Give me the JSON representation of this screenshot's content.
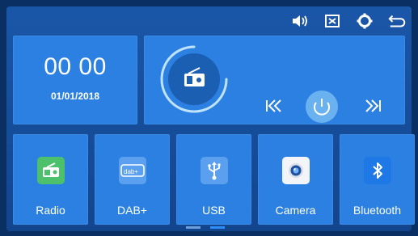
{
  "topbar": {
    "icons": [
      "volume-icon",
      "mute-icon",
      "settings-gear-icon",
      "back-icon"
    ]
  },
  "clock": {
    "time": "00 00",
    "date": "01/01/2018"
  },
  "player": {
    "source_icon": "radio-icon",
    "controls": [
      "previous-icon",
      "power-icon",
      "next-icon"
    ],
    "prev_glyph": "|<<",
    "next_glyph": ">>|"
  },
  "apps": [
    {
      "label": "Radio",
      "icon": "radio-icon",
      "color": "#4cc06a"
    },
    {
      "label": "DAB+",
      "icon": "dab-icon",
      "color": "#5aa0ee"
    },
    {
      "label": "USB",
      "icon": "usb-icon",
      "color": "#5aa0ee"
    },
    {
      "label": "Camera",
      "icon": "camera-icon",
      "color": "#f2f4f8"
    },
    {
      "label": "Bluetooth",
      "icon": "bluetooth-icon",
      "color": "#1e78e6"
    }
  ],
  "colors": {
    "accent": "#2b80e2",
    "background": "#0a2f63",
    "screen": "#1a56a8"
  },
  "pager": {
    "pages": 2,
    "active": 2
  }
}
